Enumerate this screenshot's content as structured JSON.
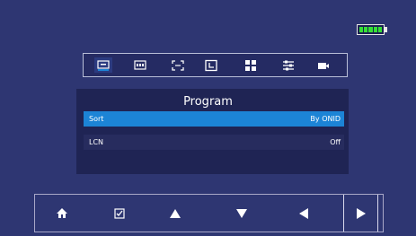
{
  "status": {
    "battery_icon": "battery-full-icon",
    "battery_color": "#35e036"
  },
  "toolbar": {
    "tools": [
      {
        "name": "program-menu-icon",
        "active": true
      },
      {
        "name": "picture-menu-icon"
      },
      {
        "name": "screen-menu-icon"
      },
      {
        "name": "time-menu-icon"
      },
      {
        "name": "apps-menu-icon"
      },
      {
        "name": "settings-menu-icon"
      },
      {
        "name": "video-menu-icon"
      }
    ]
  },
  "program": {
    "title": "Program",
    "rows": [
      {
        "label": "Sort",
        "value": "By ONID",
        "selected": true
      },
      {
        "label": "LCN",
        "value": "Off",
        "selected": false
      }
    ]
  },
  "navbar": {
    "buttons": [
      {
        "name": "home-icon"
      },
      {
        "name": "checkbox-icon"
      },
      {
        "name": "up-arrow-icon"
      },
      {
        "name": "down-arrow-icon"
      },
      {
        "name": "left-arrow-icon"
      },
      {
        "name": "right-arrow-icon",
        "selected": true
      },
      {
        "name": "blank-button"
      }
    ]
  },
  "colors": {
    "background": "#2e3672",
    "panel": "#1f2454",
    "selected_row": "#1c84d6",
    "row": "#272c5e"
  }
}
